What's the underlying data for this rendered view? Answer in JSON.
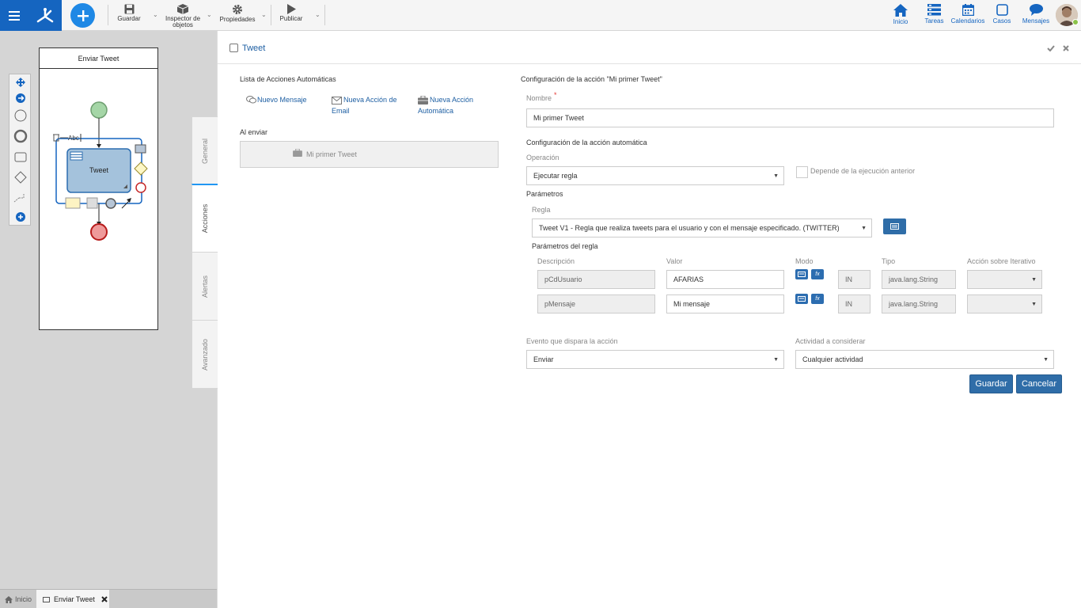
{
  "toolbar": {
    "guardar": "Guardar",
    "inspector_line1": "Inspector de",
    "inspector_line2": "objetos",
    "propiedades": "Propiedades",
    "publicar": "Publicar"
  },
  "nav": {
    "inicio": "Inicio",
    "tareas": "Tareas",
    "calendarios": "Calendarios",
    "casos": "Casos",
    "mensajes": "Mensajes"
  },
  "diagram": {
    "pool_title": "Enviar Tweet",
    "task_label": "Tweet",
    "abc_label": "Abc"
  },
  "bottom_tabs": {
    "inicio": "Inicio",
    "enviar_tweet": "Enviar Tweet"
  },
  "panel": {
    "title": "Tweet",
    "vtabs": [
      "General",
      "Acciones",
      "Alertas",
      "Avanzado"
    ],
    "left": {
      "list_title": "Lista de Acciones Automáticas",
      "nuevo_mensaje": "Nuevo Mensaje",
      "nueva_email_1": "Nueva Acción de",
      "nueva_email_2": "Email",
      "nueva_auto_1": "Nueva Acción",
      "nueva_auto_2": "Automática",
      "al_enviar": "Al enviar",
      "action_item": "Mi primer Tweet"
    },
    "right": {
      "config_title": "Configuración de la acción \"Mi primer Tweet\"",
      "nombre_label": "Nombre",
      "required_mark": "*",
      "nombre_value": "Mi primer Tweet",
      "config_auto": "Configuración de la acción automática",
      "operacion_label": "Operación",
      "operacion_value": "Ejecutar regla",
      "depende_label": "Depende de la ejecución anterior",
      "parametros_label": "Parámetros",
      "regla_label": "Regla",
      "regla_value": "Tweet V1 - Regla que realiza tweets para el usuario y con el mensaje especificado. (TWITTER)",
      "params_regla_label": "Parámetros del regla",
      "columns": [
        "Descripción",
        "Valor",
        "Modo",
        "Tipo",
        "Acción sobre Iterativo"
      ],
      "rows": [
        {
          "descripcion": "pCdUsuario",
          "valor": "AFARIAS",
          "modo": "IN",
          "tipo": "java.lang.String"
        },
        {
          "descripcion": "pMensaje",
          "valor": "Mi mensaje",
          "modo": "IN",
          "tipo": "java.lang.String"
        }
      ],
      "fx_label": "fx",
      "evento_label": "Evento que dispara la acción",
      "evento_value": "Enviar",
      "actividad_label": "Actividad a considerar",
      "actividad_value": "Cualquier actividad",
      "guardar_btn": "Guardar",
      "cancelar_btn": "Cancelar"
    }
  },
  "colors": {
    "brand_blue": "#1565c0",
    "link_blue": "#1e5fa3",
    "button_blue": "#2f6da8",
    "start_event": "#a5d6a7",
    "end_event": "#ef9a9a"
  }
}
